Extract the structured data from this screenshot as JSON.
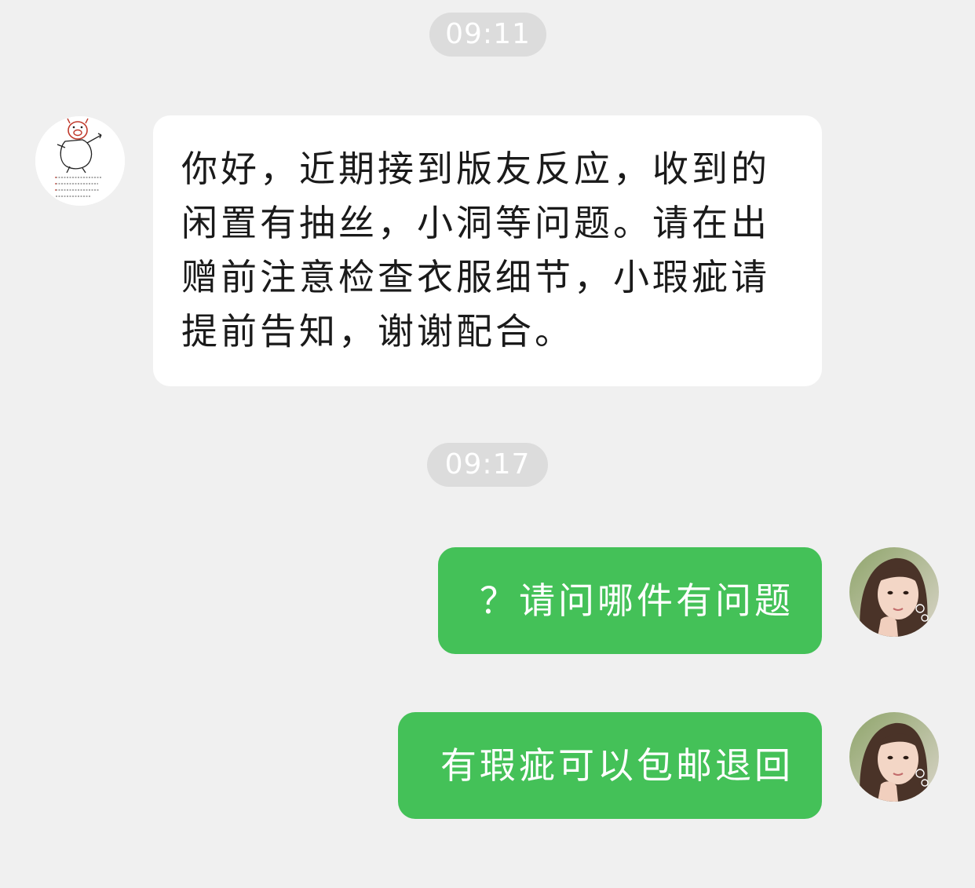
{
  "timestamps": [
    "09:11",
    "09:17"
  ],
  "messages": [
    {
      "sender": "other",
      "text": "你好，近期接到版友反应，收到的闲置有抽丝，小洞等问题。请在出赠前注意检查衣服细节，小瑕疵请提前告知，谢谢配合。"
    },
    {
      "sender": "self",
      "text": "？请问哪件有问题"
    },
    {
      "sender": "self",
      "text": "有瑕疵可以包邮退回"
    }
  ],
  "avatars": {
    "other": "cartoon-pig-avatar",
    "self": "selfie-photo-avatar"
  },
  "colors": {
    "background": "#f0f0f0",
    "timestamp_pill": "#dcdcdc",
    "incoming_bubble": "#ffffff",
    "outgoing_bubble": "#44c158"
  }
}
